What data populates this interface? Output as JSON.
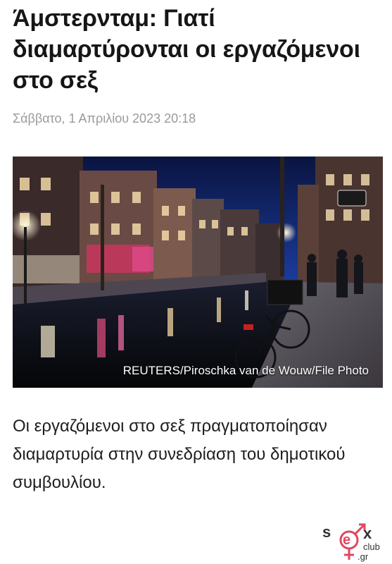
{
  "article": {
    "title": "Άμστερνταμ: Γιατί διαμαρτύρονται οι εργαζόμενοι στο σεξ",
    "date": "Σάββατο, 1 Απριλίου 2023 20:18",
    "photo_credit": "REUTERS/Piroschka van de Wouw/File Photo",
    "lead": "Οι εργαζόμενοι στο σεξ πραγματοποίησαν διαμαρτυρία στην συνεδρίαση του δημοτικού συμβουλίου."
  },
  "logo": {
    "mark": "sex",
    "word": "club",
    "tld": ".gr",
    "color": "#e0475f"
  }
}
